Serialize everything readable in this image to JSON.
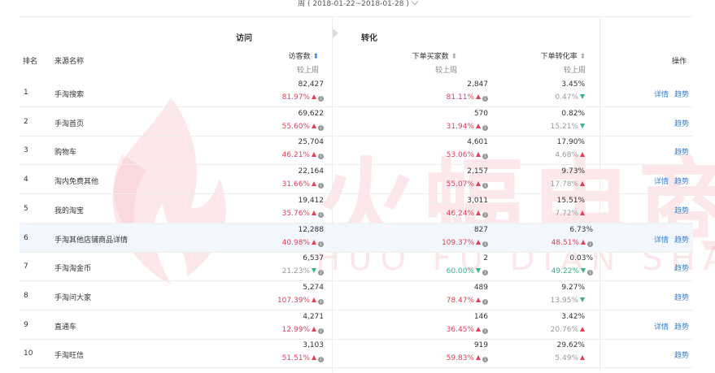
{
  "date_range": "周 ( 2018-01-22~2018-01-28 )",
  "groups": {
    "visit": "访问",
    "convert": "转化"
  },
  "columns": {
    "rank": "排名",
    "source": "来源名称",
    "visitors": "访客数",
    "buyers": "下单买家数",
    "rate": "下单转化率",
    "ops": "操作",
    "compare": "较上周"
  },
  "actions": {
    "detail": "详情",
    "trend": "趋势"
  },
  "watermark": {
    "main": "火蝠电商",
    "sub": "HUO FU DIAN SHANG"
  },
  "rows": [
    {
      "rank": "1",
      "name": "手淘搜索",
      "visitors": "82,427",
      "visitors_chg": "81.97%",
      "visitors_dir": "up",
      "buyers": "2,847",
      "buyers_chg": "81.11%",
      "buyers_dir": "up",
      "rate": "3.45%",
      "rate_chg": "0.47%",
      "rate_dir": "down",
      "detail": true,
      "highlight": false
    },
    {
      "rank": "2",
      "name": "手淘首页",
      "visitors": "69,622",
      "visitors_chg": "55.60%",
      "visitors_dir": "up",
      "buyers": "570",
      "buyers_chg": "31.94%",
      "buyers_dir": "up",
      "rate": "0.82%",
      "rate_chg": "15.21%",
      "rate_dir": "down",
      "detail": false,
      "highlight": false
    },
    {
      "rank": "3",
      "name": "购物车",
      "visitors": "25,704",
      "visitors_chg": "46.21%",
      "visitors_dir": "up",
      "buyers": "4,601",
      "buyers_chg": "53.06%",
      "buyers_dir": "up",
      "rate": "17.90%",
      "rate_chg": "4.68%",
      "rate_dir": "up",
      "detail": false,
      "highlight": false
    },
    {
      "rank": "4",
      "name": "淘内免费其他",
      "visitors": "22,164",
      "visitors_chg": "31.66%",
      "visitors_dir": "up",
      "buyers": "2,157",
      "buyers_chg": "55.07%",
      "buyers_dir": "up",
      "rate": "9.73%",
      "rate_chg": "17.78%",
      "rate_dir": "up",
      "detail": true,
      "highlight": false
    },
    {
      "rank": "5",
      "name": "我的淘宝",
      "visitors": "19,412",
      "visitors_chg": "35.76%",
      "visitors_dir": "up",
      "buyers": "3,011",
      "buyers_chg": "46.24%",
      "buyers_dir": "up",
      "rate": "15.51%",
      "rate_chg": "7.72%",
      "rate_dir": "up",
      "detail": false,
      "highlight": false
    },
    {
      "rank": "6",
      "name": "手淘其他店铺商品详情",
      "visitors": "12,288",
      "visitors_chg": "40.98%",
      "visitors_dir": "up",
      "buyers": "827",
      "buyers_chg": "109.37%",
      "buyers_dir": "up",
      "rate": "6.73%",
      "rate_chg": "48.51%",
      "rate_dir": "up",
      "detail": true,
      "highlight": true
    },
    {
      "rank": "7",
      "name": "手淘淘金币",
      "visitors": "6,537",
      "visitors_chg": "21.23%",
      "visitors_dir": "down",
      "buyers": "2",
      "buyers_chg": "60.00%",
      "buyers_dir": "down",
      "rate": "0.03%",
      "rate_chg": "49.22%",
      "rate_dir": "down",
      "detail": false,
      "highlight": false
    },
    {
      "rank": "8",
      "name": "手淘问大家",
      "visitors": "5,274",
      "visitors_chg": "107.39%",
      "visitors_dir": "up",
      "buyers": "489",
      "buyers_chg": "78.47%",
      "buyers_dir": "up",
      "rate": "9.27%",
      "rate_chg": "13.95%",
      "rate_dir": "down",
      "detail": false,
      "highlight": false
    },
    {
      "rank": "9",
      "name": "直通车",
      "visitors": "4,271",
      "visitors_chg": "12.99%",
      "visitors_dir": "up",
      "buyers": "146",
      "buyers_chg": "36.45%",
      "buyers_dir": "up",
      "rate": "3.42%",
      "rate_chg": "20.76%",
      "rate_dir": "up",
      "detail": true,
      "highlight": false
    },
    {
      "rank": "10",
      "name": "手淘旺信",
      "visitors": "3,103",
      "visitors_chg": "51.51%",
      "visitors_dir": "up",
      "buyers": "919",
      "buyers_chg": "59.83%",
      "buyers_dir": "up",
      "rate": "29.62%",
      "rate_chg": "5.49%",
      "rate_dir": "up",
      "detail": false,
      "highlight": false
    }
  ],
  "colors": {
    "up": "#e0405a",
    "down": "#30b580",
    "link": "#3a7fd5"
  }
}
